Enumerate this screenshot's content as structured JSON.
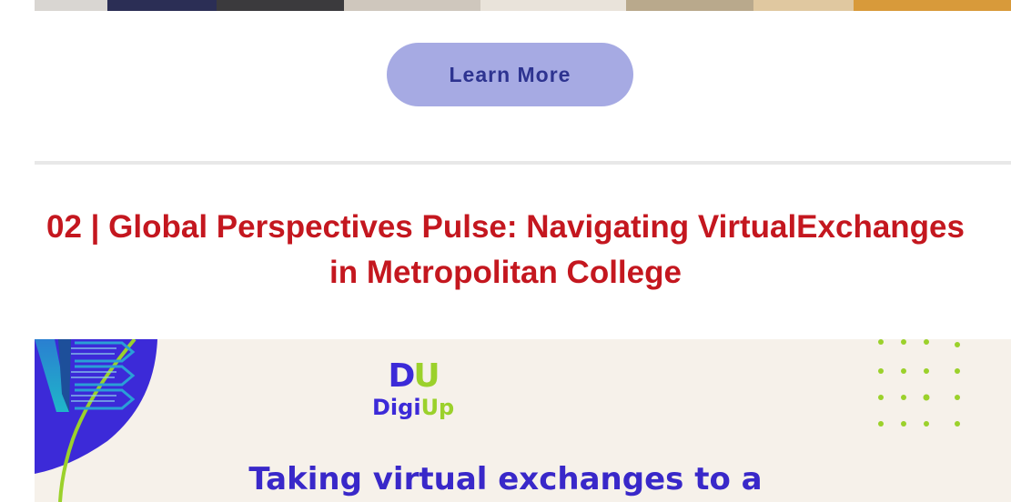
{
  "learn_more": {
    "label": "Learn More"
  },
  "section": {
    "title": "02 | Global Perspectives Pulse: Navigating VirtualExchanges in Metropolitan College"
  },
  "banner": {
    "logo_mark_d": "D",
    "logo_mark_u": "U",
    "logo_word_digi": "Digi",
    "logo_word_up": "Up",
    "headline": "Taking virtual exchanges to a"
  },
  "colors": {
    "title_red": "#c4171f",
    "button_bg": "#a6aae3",
    "button_text": "#2d3390",
    "brand_purple": "#3c2ad8",
    "brand_green": "#9bd12b"
  }
}
